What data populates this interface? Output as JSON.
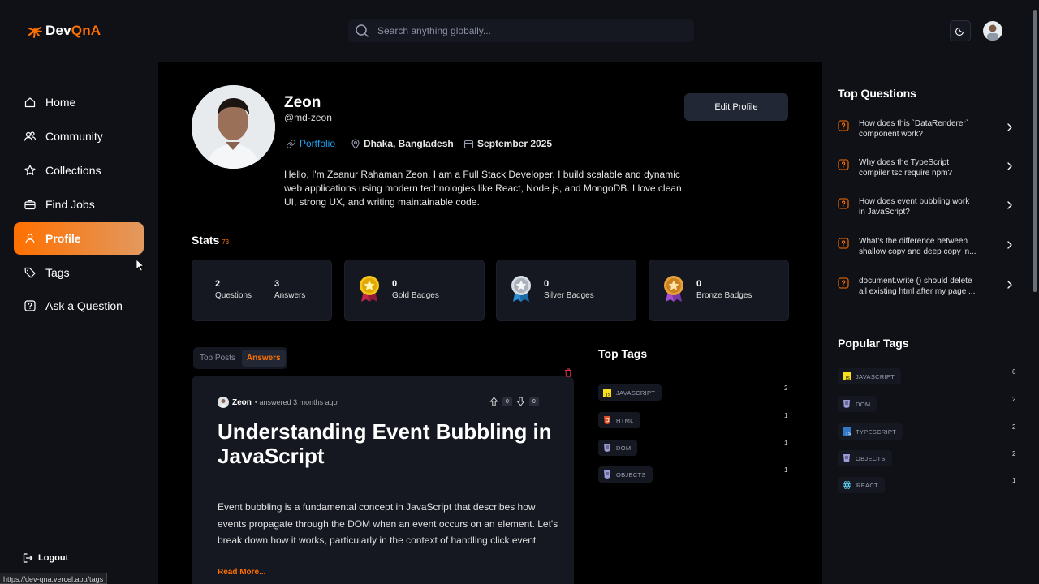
{
  "app": {
    "logo_dev": "Dev",
    "logo_qna": "QnA"
  },
  "search": {
    "placeholder": "Search anything globally..."
  },
  "nav": {
    "items": [
      {
        "label": "Home",
        "icon": "home-icon"
      },
      {
        "label": "Community",
        "icon": "users-icon"
      },
      {
        "label": "Collections",
        "icon": "star-icon"
      },
      {
        "label": "Find Jobs",
        "icon": "briefcase-icon"
      },
      {
        "label": "Profile",
        "icon": "user-icon",
        "active": true
      },
      {
        "label": "Tags",
        "icon": "tag-icon"
      },
      {
        "label": "Ask a Question",
        "icon": "question-icon"
      }
    ],
    "logout": "Logout"
  },
  "status_url": "https://dev-qna.vercel.app/tags",
  "profile": {
    "name": "Zeon",
    "username": "@md-zeon",
    "edit_label": "Edit Profile",
    "portfolio": "Portfolio",
    "location": "Dhaka, Bangladesh",
    "joined": "September 2025",
    "bio": "Hello, I'm Zeanur Rahaman Zeon. I am a Full Stack Developer. I build scalable and dynamic web applications using modern technologies like React, Node.js, and MongoDB. I love clean UI, strong UX, and writing maintainable code."
  },
  "stats": {
    "title": "Stats",
    "reputation": "73",
    "questions": "2",
    "questions_label": "Questions",
    "answers": "3",
    "answers_label": "Answers",
    "gold": "0",
    "gold_label": "Gold Badges",
    "silver": "0",
    "silver_label": "Silver Badges",
    "bronze": "0",
    "bronze_label": "Bronze Badges"
  },
  "tabs": {
    "top_posts": "Top Posts",
    "answers": "Answers"
  },
  "answer": {
    "author": "Zeon",
    "time": "• answered 3 months ago",
    "upvotes": "0",
    "downvotes": "0",
    "title": "Understanding Event Bubbling in JavaScript",
    "body": "Event bubbling is a fundamental concept in JavaScript that describes how events propagate through the DOM when an event occurs on an element. Let's break down how it works, particularly in the context of handling click event",
    "read_more": "Read More..."
  },
  "top_tags": {
    "title": "Top Tags",
    "items": [
      {
        "name": "JAVASCRIPT",
        "count": "2",
        "color": "#f7df1e"
      },
      {
        "name": "HTML",
        "count": "1",
        "color": "#e34f26"
      },
      {
        "name": "DOM",
        "count": "1",
        "color": "#9b9bd8"
      },
      {
        "name": "OBJECTS",
        "count": "1",
        "color": "#9b9bd8"
      }
    ]
  },
  "top_questions": {
    "title": "Top Questions",
    "items": [
      {
        "line1": "How does this `DataRenderer`",
        "line2": "component work?"
      },
      {
        "line1": "Why does the TypeScript",
        "line2": "compiler tsc require npm?"
      },
      {
        "line1": "How does event bubbling work",
        "line2": "in JavaScript?"
      },
      {
        "line1": "What's the difference between",
        "line2": "shallow copy and deep copy in..."
      },
      {
        "line1": "document.write () should delete",
        "line2": "all existing html after my page ..."
      }
    ]
  },
  "popular_tags": {
    "title": "Popular Tags",
    "items": [
      {
        "name": "JAVASCRIPT",
        "count": "6",
        "color": "#f7df1e"
      },
      {
        "name": "DOM",
        "count": "2",
        "color": "#9b9bd8"
      },
      {
        "name": "TYPESCRIPT",
        "count": "2",
        "color": "#3178c6"
      },
      {
        "name": "OBJECTS",
        "count": "2",
        "color": "#9b9bd8"
      },
      {
        "name": "REACT",
        "count": "1",
        "color": "#61dafb"
      }
    ]
  },
  "colors": {
    "accent": "#ff7000",
    "link": "#1da1f2"
  }
}
